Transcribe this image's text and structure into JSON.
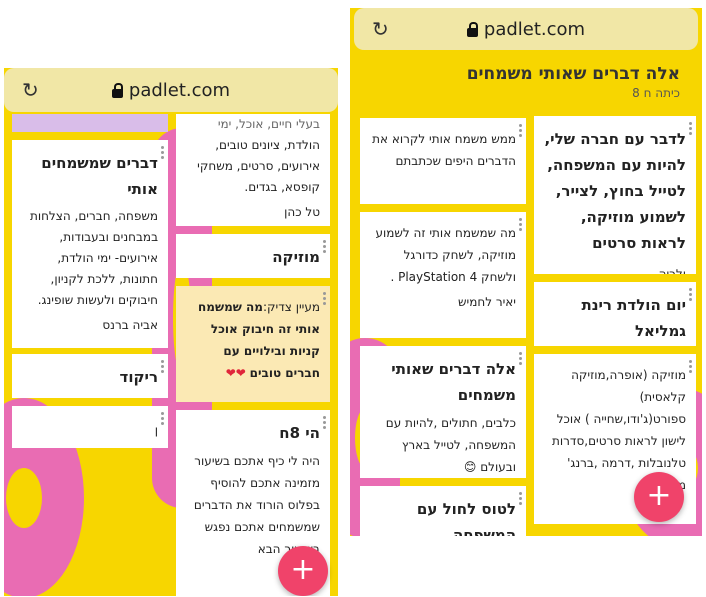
{
  "left": {
    "url": "padlet.com",
    "col_right": {
      "card1": {
        "title": "דברים שמשמחים אותי",
        "body": "משפחה, חברים, הצלחות במבחנים ובעבודות, אירועים- ימי הולדת, חתונות, ללכת לקניון, חיבוקים ולעשות שופינג.",
        "author": "אביה ברנס"
      },
      "card2": {
        "title": "ריקוד"
      },
      "card3": {
        "title": "ן"
      }
    },
    "col_left": {
      "card1": {
        "body_top": "בעלי חיים, אוכל, ימי",
        "body": "הולדת, ציונים טובים, אירועים, סרטים, משחקי קופסא, בגדים.",
        "author": "טל כהן"
      },
      "card2": {
        "title": "מוזיקה"
      },
      "card3": {
        "prefix": "מעיין צדיק:",
        "body": "מה שמשמח אותי זה חיבוק אוכל קניות ובילויים עם חברים טובים",
        "hearts": "❤❤"
      },
      "card4": {
        "title": "הי 8ח",
        "body": "היה לי כיף אתכם בשיעור מזמינה אתכם להוסיף בפלוס הורוד את הדברים שמשמחים אתכם נפגש בשיעור הבא"
      }
    },
    "fab": "+"
  },
  "right": {
    "url": "padlet.com",
    "header": {
      "title": "אלה דברים שאותי משמחים",
      "subtitle": "כיתה ח 8"
    },
    "col_right": {
      "card1": {
        "title": "לדבר עם חברה שלי, להיות עם המשפחה, לטייל בחוץ, לצייר, לשמוע מוזיקה, לראות סרטים",
        "author": "ולריה"
      },
      "card2": {
        "title": "יום הולדת רינת גמליאל"
      },
      "card3": {
        "body": "מוזיקה (אופרה,מוזיקה קלאסית) ספורט(ג'ודו,שחייה ) אוכל לישון לראות סרטים,סדרות טלנובלות ,דרמה ,ברנג' מזרחי"
      }
    },
    "col_left": {
      "card1": {
        "body": "ממש משמח אותי לקרוא את הדברים היפים שכתבתם"
      },
      "card2": {
        "body": "מה שמשמח אותי זה לשמוע מוזיקה, לשחק כדורגל ולשחק PlayStation 4 .",
        "author": "יאיר לחמיש"
      },
      "card3": {
        "title": "אלה דברים שאותי משמחים",
        "body": "כלבים, חתולים ,להיות עם המשפחה, לטייל בארץ ובעולם",
        "emoji": "😊"
      },
      "card4": {
        "title": "לטוס לחול עם המשפחה"
      }
    },
    "fab": "+"
  },
  "colors": {
    "background": "#f7d600",
    "fab": "#f0436a",
    "donut": "#e96cb3",
    "card_note": "#fbe9b4",
    "purple_card": "#d9bde9"
  }
}
